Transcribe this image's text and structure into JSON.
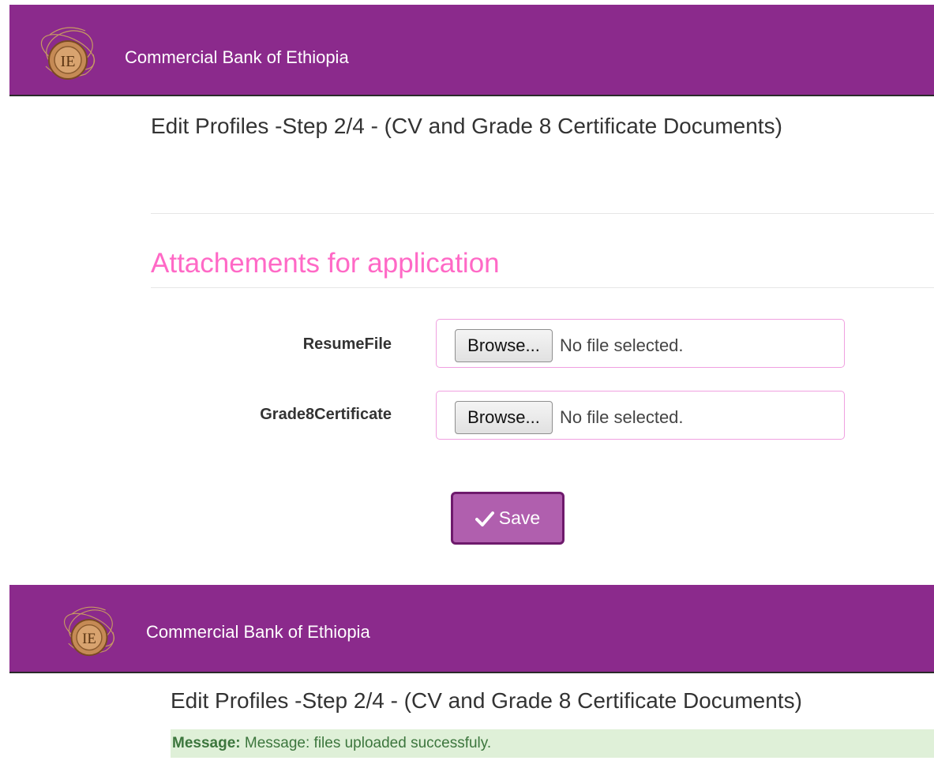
{
  "colors": {
    "navbar": "#8b2a8c",
    "section_title": "#ff69c6",
    "save_button": "#b05fae",
    "message_bg": "#dff0d8",
    "message_text": "#3c763d"
  },
  "top": {
    "brand": "Commercial Bank of Ethiopia",
    "title": "Edit Profiles -Step 2/4 - (CV and Grade 8 Certificate Documents)",
    "section_title": "Attachements for application",
    "fields": [
      {
        "label": "ResumeFile",
        "button": "Browse...",
        "status": "No file selected."
      },
      {
        "label": "Grade8Certificate",
        "button": "Browse...",
        "status": "No file selected."
      }
    ],
    "save_label": "Save",
    "save_icon": "checkmark-icon"
  },
  "bottom": {
    "brand": "Commercial Bank of Ethiopia",
    "title": "Edit Profiles -Step 2/4 - (CV and Grade 8 Certificate Documents)",
    "message_label": "Message:",
    "message_text": "Message: files uploaded successfuly."
  },
  "logo": "bank-emblem-logo"
}
